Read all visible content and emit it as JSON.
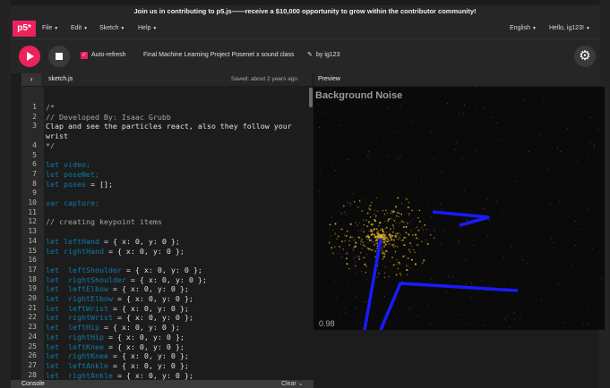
{
  "banner": "Join us in contributing to p5.js——receive a $10,000 opportunity to grow within the contributor community!",
  "nav": {
    "logo": "p5*",
    "menus": [
      "File",
      "Edit",
      "Sketch",
      "Help"
    ],
    "language": "English",
    "user": "Hello, ig123!"
  },
  "toolbar": {
    "auto_refresh": "Auto-refresh",
    "project_name": "Final Machine Learning Project Posenet x sound class",
    "by": "by ig123",
    "auto_refresh_checked": true
  },
  "editor": {
    "file_name": "sketch.js",
    "saved": "Saved: about 2 years ago",
    "lines": [
      {
        "n": "1",
        "segs": [
          {
            "t": "/*",
            "c": "comment"
          }
        ]
      },
      {
        "n": "2",
        "segs": [
          {
            "t": "// Developed By: Isaac Grubb",
            "c": "comment"
          }
        ]
      },
      {
        "n": "3",
        "segs": [
          {
            "t": "Clap and see the particles react, also they follow your",
            "c": "txt"
          }
        ]
      },
      {
        "n": "",
        "segs": [
          {
            "t": "wrist",
            "c": "txt"
          }
        ]
      },
      {
        "n": "4",
        "segs": [
          {
            "t": "*/",
            "c": "comment"
          }
        ]
      },
      {
        "n": "5",
        "segs": []
      },
      {
        "n": "6",
        "segs": [
          {
            "t": "let",
            "c": "kw"
          },
          {
            "t": " video;",
            "c": "id"
          }
        ]
      },
      {
        "n": "7",
        "segs": [
          {
            "t": "let",
            "c": "kw"
          },
          {
            "t": " poseNet;",
            "c": "id"
          }
        ]
      },
      {
        "n": "8",
        "segs": [
          {
            "t": "let",
            "c": "kw"
          },
          {
            "t": " poses",
            "c": "id"
          },
          {
            "t": " = [];",
            "c": "txt"
          }
        ]
      },
      {
        "n": "9",
        "segs": []
      },
      {
        "n": "10",
        "segs": [
          {
            "t": "var",
            "c": "kw"
          },
          {
            "t": " capture;",
            "c": "id"
          }
        ]
      },
      {
        "n": "11",
        "segs": []
      },
      {
        "n": "12",
        "segs": [
          {
            "t": "// creating keypoint items",
            "c": "comment"
          }
        ]
      },
      {
        "n": "13",
        "segs": []
      },
      {
        "n": "14",
        "segs": [
          {
            "t": "let",
            "c": "kw"
          },
          {
            "t": " leftHand",
            "c": "id"
          },
          {
            "t": " = { x: 0, y: 0 };",
            "c": "txt"
          }
        ]
      },
      {
        "n": "15",
        "segs": [
          {
            "t": "let",
            "c": "kw"
          },
          {
            "t": " rightHand",
            "c": "id"
          },
          {
            "t": " = { x: 0, y: 0 };",
            "c": "txt"
          }
        ]
      },
      {
        "n": "16",
        "segs": []
      },
      {
        "n": "17",
        "segs": [
          {
            "t": "let",
            "c": "kw"
          },
          {
            "t": "  leftShoulder",
            "c": "id"
          },
          {
            "t": " = { x: 0, y: 0 };",
            "c": "txt"
          }
        ]
      },
      {
        "n": "18",
        "segs": [
          {
            "t": "let",
            "c": "kw"
          },
          {
            "t": "  rightShoulder",
            "c": "id"
          },
          {
            "t": " = { x: 0, y: 0 };",
            "c": "txt"
          }
        ]
      },
      {
        "n": "19",
        "segs": [
          {
            "t": "let",
            "c": "kw"
          },
          {
            "t": "  leftElbow",
            "c": "id"
          },
          {
            "t": " = { x: 0, y: 0 };",
            "c": "txt"
          }
        ]
      },
      {
        "n": "20",
        "segs": [
          {
            "t": "let",
            "c": "kw"
          },
          {
            "t": "  rightElbow",
            "c": "id"
          },
          {
            "t": " = { x: 0, y: 0 };",
            "c": "txt"
          }
        ]
      },
      {
        "n": "21",
        "segs": [
          {
            "t": "let",
            "c": "kw"
          },
          {
            "t": "  leftWrist",
            "c": "id"
          },
          {
            "t": " = { x: 0, y: 0 };",
            "c": "txt"
          }
        ]
      },
      {
        "n": "22",
        "segs": [
          {
            "t": "let",
            "c": "kw"
          },
          {
            "t": "  rightWrist",
            "c": "id"
          },
          {
            "t": " = { x: 0, y: 0 };",
            "c": "txt"
          }
        ]
      },
      {
        "n": "23",
        "segs": [
          {
            "t": "let",
            "c": "kw"
          },
          {
            "t": "  leftHip",
            "c": "id"
          },
          {
            "t": " = { x: 0, y: 0 };",
            "c": "txt"
          }
        ]
      },
      {
        "n": "24",
        "segs": [
          {
            "t": "let",
            "c": "kw"
          },
          {
            "t": "  rightHip",
            "c": "id"
          },
          {
            "t": " = { x: 0, y: 0 };",
            "c": "txt"
          }
        ]
      },
      {
        "n": "25",
        "segs": [
          {
            "t": "let",
            "c": "kw"
          },
          {
            "t": "  leftKnee",
            "c": "id"
          },
          {
            "t": " = { x: 0, y: 0 };",
            "c": "txt"
          }
        ]
      },
      {
        "n": "26",
        "segs": [
          {
            "t": "let",
            "c": "kw"
          },
          {
            "t": "  rightKnee",
            "c": "id"
          },
          {
            "t": " = { x: 0, y: 0 };",
            "c": "txt"
          }
        ]
      },
      {
        "n": "27",
        "segs": [
          {
            "t": "let",
            "c": "kw"
          },
          {
            "t": "  leftAnkle",
            "c": "id"
          },
          {
            "t": " = { x: 0, y: 0 };",
            "c": "txt"
          }
        ]
      },
      {
        "n": "28",
        "segs": [
          {
            "t": "let",
            "c": "kw"
          },
          {
            "t": "  rightAnkle",
            "c": "id"
          },
          {
            "t": " = { x: 0, y: 0 };",
            "c": "txt"
          }
        ]
      }
    ]
  },
  "console": {
    "label": "Console",
    "clear": "Clear"
  },
  "preview": {
    "label": "Preview",
    "title": "Background Noise",
    "value": "0.98"
  },
  "colors": {
    "accent": "#ed225d",
    "keyword": "#0b7ca9",
    "skeleton": "#1a1aff",
    "particles": "#d8b02a"
  }
}
